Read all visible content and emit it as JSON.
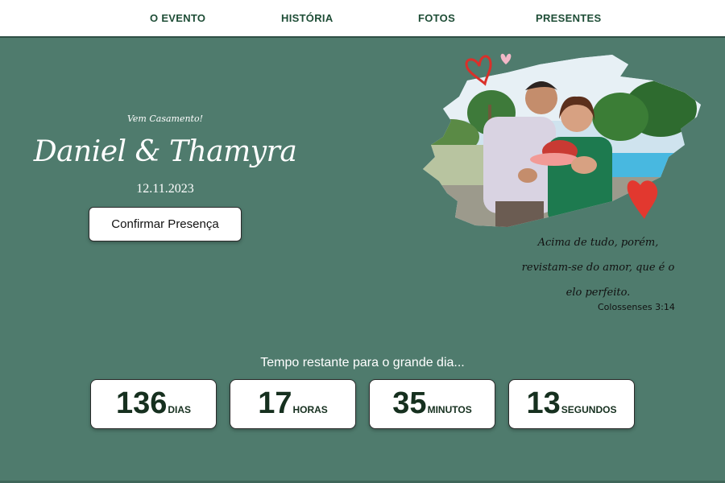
{
  "nav": {
    "items": [
      {
        "label": "O EVENTO"
      },
      {
        "label": "HISTÓRIA"
      },
      {
        "label": "FOTOS"
      },
      {
        "label": "PRESENTES"
      }
    ]
  },
  "hero": {
    "welcome": "Vem Casamento!",
    "names": "Daniel & Thamyra",
    "date": "12.11.2023",
    "confirm_label": "Confirmar Presença"
  },
  "quote": {
    "line1": "Acima de tudo, porém,",
    "line2": "revistam-se do amor, que é o",
    "line3": "elo perfeito.",
    "reference": "Colossenses 3:14"
  },
  "countdown": {
    "title": "Tempo restante para o grande dia...",
    "items": [
      {
        "value": "136",
        "unit": "DIAS"
      },
      {
        "value": "17",
        "unit": "HORAS"
      },
      {
        "value": "35",
        "unit": "MINUTOS"
      },
      {
        "value": "13",
        "unit": "SEGUNDOS"
      }
    ]
  },
  "colors": {
    "background": "#4f7b6d",
    "nav_text": "#1e4d36",
    "countdown_text": "#16301f",
    "heart_red": "#e2382f",
    "heart_pink": "#f3b8c8"
  },
  "icons": [
    "heart-outline-icon",
    "heart-pink-icon",
    "heart-red-icon"
  ]
}
